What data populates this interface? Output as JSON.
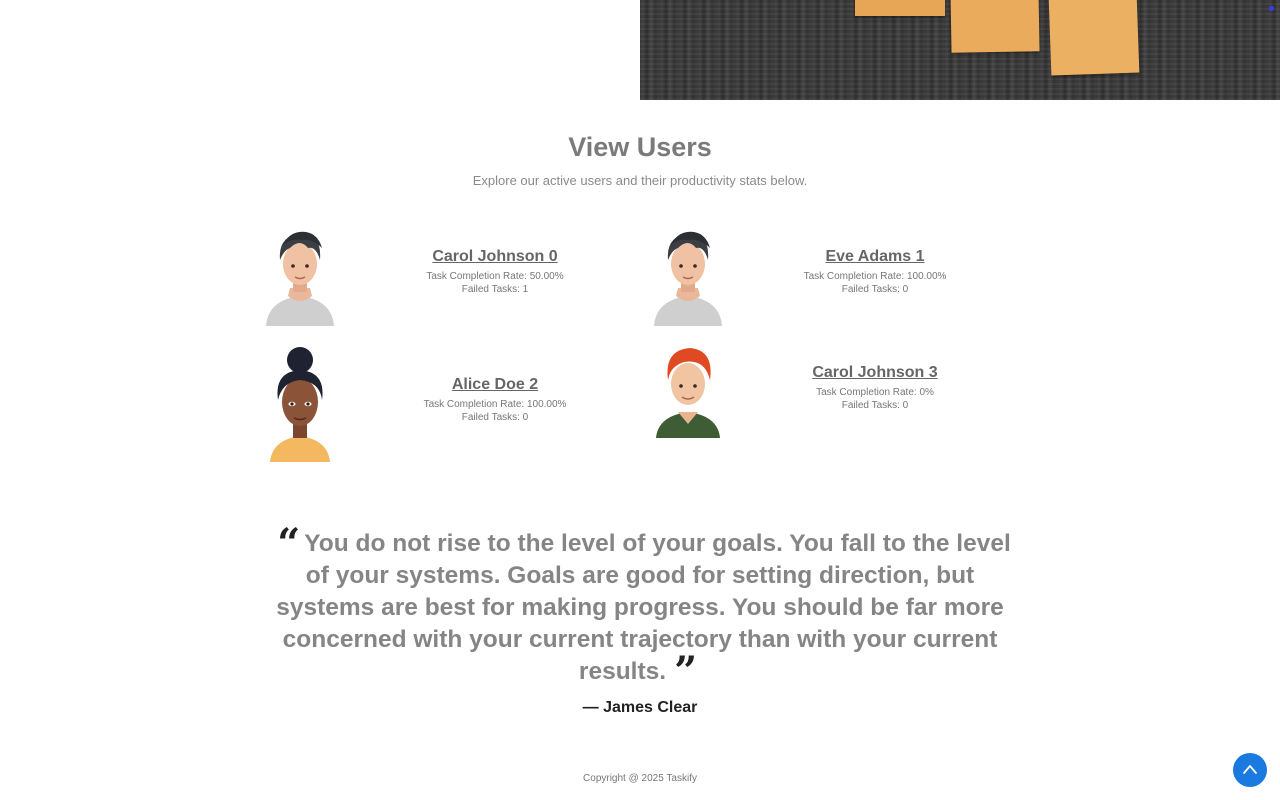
{
  "section": {
    "title": "View Users",
    "subtitle": "Explore our active users and their productivity stats below."
  },
  "users": [
    {
      "name": "Carol Johnson 0",
      "completion": "Task Completion Rate: 50.00%",
      "failed": "Failed Tasks: 1",
      "avatar": "male-avatar-gray-hair"
    },
    {
      "name": "Eve Adams 1",
      "completion": "Task Completion Rate: 100.00%",
      "failed": "Failed Tasks: 0",
      "avatar": "male-avatar-gray-hair"
    },
    {
      "name": "Alice Doe 2",
      "completion": "Task Completion Rate: 100.00%",
      "failed": "Failed Tasks: 0",
      "avatar": "female-avatar-curly-hair"
    },
    {
      "name": "Carol Johnson 3",
      "completion": "Task Completion Rate: 0%",
      "failed": "Failed Tasks: 0",
      "avatar": "male-avatar-red-hair"
    }
  ],
  "quote": {
    "text": "You do not rise to the level of your goals. You fall to the level of your systems. Goals are good for setting direction, but systems are best for making progress. You should be far more concerned with your current trajectory than with your current results.",
    "author": "— James Clear"
  },
  "footer": {
    "copyright": "Copyright @ 2025 Taskify"
  },
  "colors": {
    "accent": "#1a7ae0",
    "sticky_note": "#e8a95a"
  },
  "icons": {
    "scroll_top": "chevron-up-icon",
    "quote_open": "open-quote-icon",
    "quote_close": "close-quote-icon"
  }
}
